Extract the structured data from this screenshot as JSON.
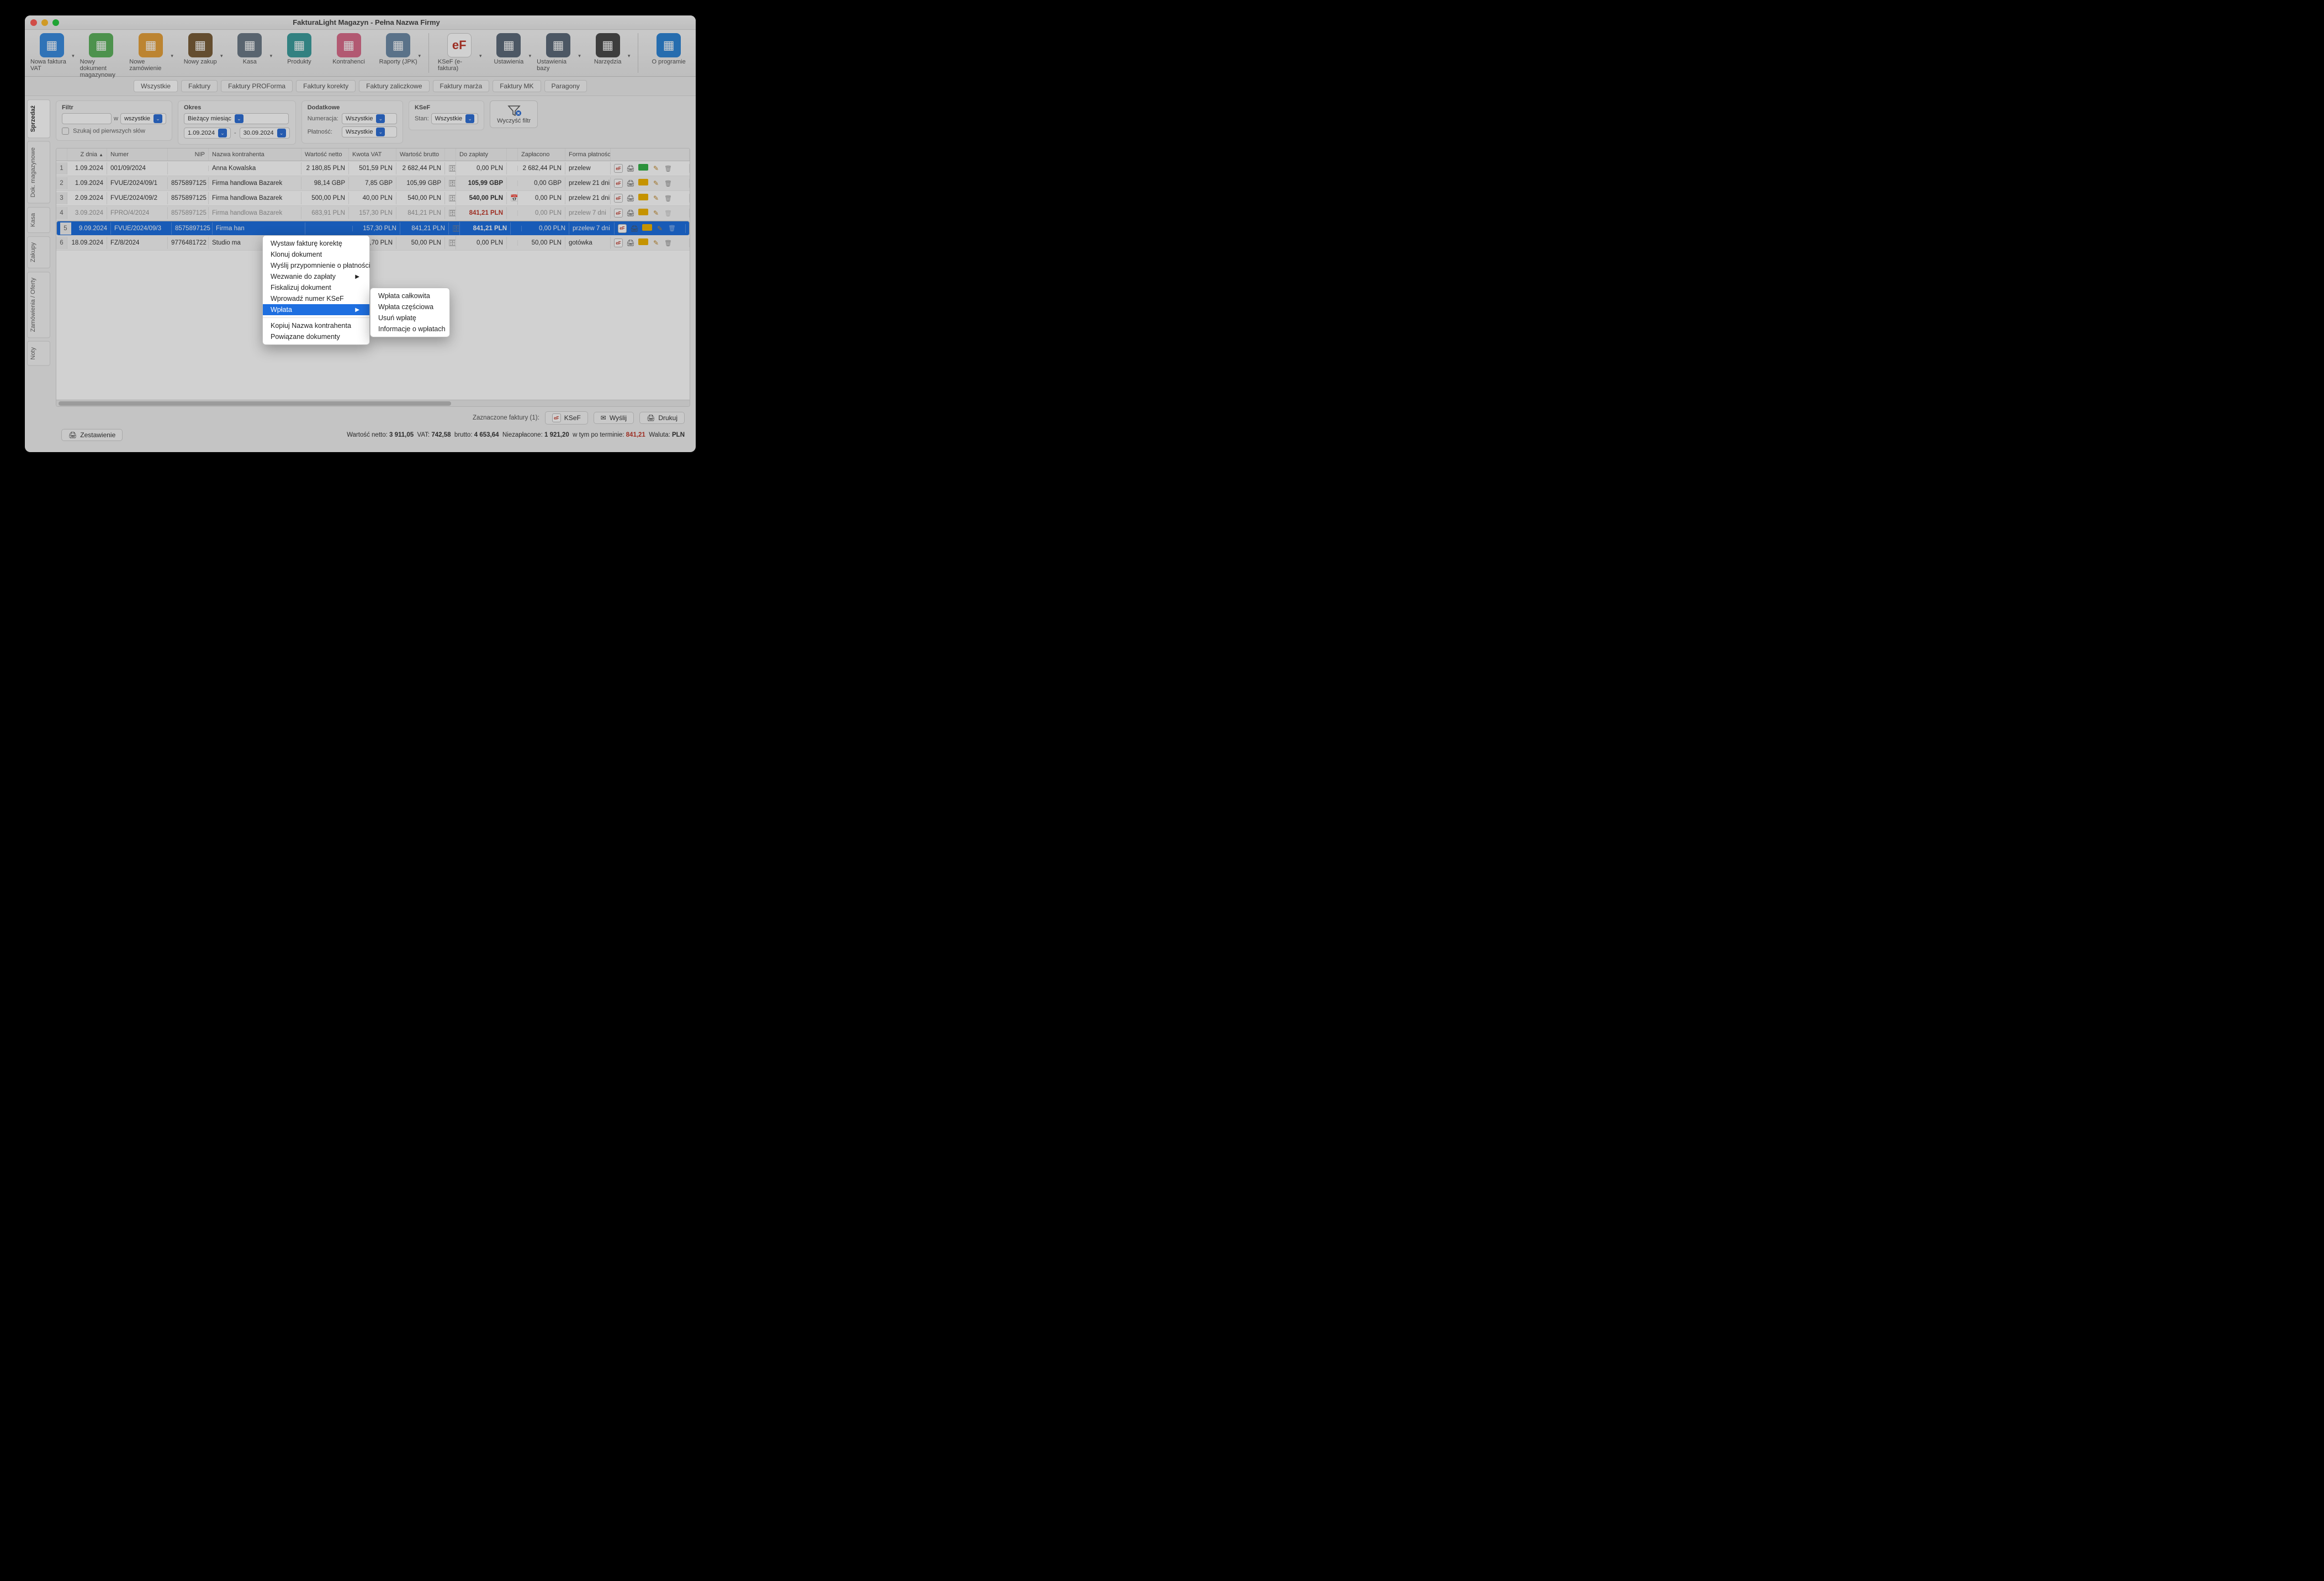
{
  "window": {
    "title": "FakturaLight Magazyn - Pełna Nazwa Firmy"
  },
  "toolbar": [
    {
      "label": "Nowa faktura VAT",
      "icon": "ic-blue",
      "dd": true
    },
    {
      "label": "Nowy dokument magazynowy",
      "icon": "ic-green",
      "dd": false
    },
    {
      "label": "Nowe zamówienie",
      "icon": "ic-orange",
      "dd": true
    },
    {
      "label": "Nowy zakup",
      "icon": "ic-brown",
      "dd": true
    },
    {
      "label": "Kasa",
      "icon": "ic-grey",
      "dd": true
    },
    {
      "label": "Produkty",
      "icon": "ic-teal",
      "dd": false
    },
    {
      "label": "Kontrahenci",
      "icon": "ic-pink",
      "dd": false
    },
    {
      "label": "Raporty (JPK)",
      "icon": "ic-steel",
      "dd": true
    },
    {
      "sep": true
    },
    {
      "label": "KSeF (e-faktura)",
      "icon": "ic-ksef",
      "dd": true
    },
    {
      "label": "Ustawienia",
      "icon": "ic-slate",
      "dd": true
    },
    {
      "label": "Ustawienia bazy",
      "icon": "ic-slate",
      "dd": true
    },
    {
      "label": "Narzędzia",
      "icon": "ic-dark",
      "dd": true
    },
    {
      "sep": true
    },
    {
      "label": "O programie",
      "icon": "ic-info",
      "dd": false
    }
  ],
  "subtabs": [
    "Wszystkie",
    "Faktury",
    "Faktury PROForma",
    "Faktury korekty",
    "Faktury zaliczkowe",
    "Faktury marża",
    "Faktury MK",
    "Paragony"
  ],
  "subtab_active": 0,
  "sidetabs": [
    "Sprzedaż",
    "Dok. magazynowe",
    "Kasa",
    "Zakupy",
    "Zamówienia / Oferty",
    "Noty"
  ],
  "sidetab_active": 0,
  "filters": {
    "flt_label": "Filtr",
    "w": "w",
    "w_sel": "wszystkie",
    "search_first_words": "Szukaj od pierwszych słów",
    "okres_label": "Okres",
    "okres_sel": "Bieżący miesiąc",
    "date_from": "1.09.2024",
    "date_to": "30.09.2024",
    "dash": "-",
    "dodatkowe_label": "Dodatkowe",
    "numeracja_lbl": "Numeracja:",
    "numeracja_sel": "Wszystkie",
    "platnosc_lbl": "Płatność:",
    "platnosc_sel": "Wszystkie",
    "ksef_label": "KSeF",
    "stan_lbl": "Stan:",
    "stan_sel": "Wszystkie",
    "clear_label": "Wyczyść filtr"
  },
  "columns": [
    "",
    "Z dnia",
    "Numer",
    "NIP",
    "Nazwa kontrahenta",
    "Wartość netto",
    "Kwota VAT",
    "Wartość brutto",
    "",
    "Do zapłaty",
    "",
    "Zapłacono",
    "Forma płatności",
    ""
  ],
  "rows": [
    {
      "n": "1",
      "date": "1.09.2024",
      "num": "001/09/2024",
      "nip": "",
      "name": "Anna Kowalska",
      "netto": "2 180,85 PLN",
      "vat": "501,59 PLN",
      "brutto": "2 682,44 PLN",
      "ico": "🗄",
      "due": "0,00 PLN",
      "zap": "2 682,44 PLN",
      "form": "przelew",
      "mail": "green"
    },
    {
      "n": "2",
      "date": "1.09.2024",
      "num": "FVUE/2024/09/1",
      "nip": "8575897125",
      "name": "Firma handlowa Bazarek",
      "netto": "98,14 GBP",
      "vat": "7,85 GBP",
      "brutto": "105,99 GBP",
      "ico": "🗄",
      "due": "105,99 GBP",
      "due_bold": true,
      "zap": "0,00 GBP",
      "form": "przelew 21 dni",
      "mail": "y"
    },
    {
      "n": "3",
      "date": "2.09.2024",
      "num": "FVUE/2024/09/2",
      "nip": "8575897125",
      "name": "Firma handlowa Bazarek",
      "netto": "500,00 PLN",
      "vat": "40,00 PLN",
      "brutto": "540,00 PLN",
      "ico": "🗄",
      "due": "540,00 PLN",
      "due_bold": true,
      "ico2": "📅",
      "zap": "0,00 PLN",
      "form": "przelew 21 dni",
      "mail": "y"
    },
    {
      "n": "4",
      "date": "3.09.2024",
      "num": "FPRO/4/2024",
      "nip": "8575897125",
      "name": "Firma handlowa Bazarek",
      "netto": "683,91 PLN",
      "vat": "157,30 PLN",
      "brutto": "841,21 PLN",
      "ico": "🗄",
      "due": "841,21 PLN",
      "due_red": true,
      "zap": "0,00 PLN",
      "form": "przelew 7 dni",
      "dim": true,
      "mail": "y"
    },
    {
      "n": "5",
      "date": "9.09.2024",
      "num": "FVUE/2024/09/3",
      "nip": "8575897125",
      "name": "Firma han",
      "netto": "",
      "vat": "157,30 PLN",
      "brutto": "841,21 PLN",
      "ico": "🗄",
      "due": "841,21 PLN",
      "due_bold": true,
      "zap": "0,00 PLN",
      "form": "przelew 7 dni",
      "sel": true,
      "mail": "y"
    },
    {
      "n": "6",
      "date": "18.09.2024",
      "num": "FZ/8/2024",
      "nip": "9776481722",
      "name": "Studio ma",
      "netto": "",
      "vat": "3,70 PLN",
      "brutto": "50,00 PLN",
      "ico": "🗄",
      "due": "0,00 PLN",
      "zap": "50,00 PLN",
      "form": "gotówka",
      "mail": "y"
    }
  ],
  "context_menu": {
    "items": [
      "Wystaw fakturę korektę",
      "Klonuj dokument",
      "Wyślij przypomnienie o płatności",
      {
        "label": "Wezwanie do zapłaty",
        "sub": true
      },
      "Fiskalizuj dokument",
      "Wprowadź numer KSeF",
      {
        "label": "Wpłata",
        "sub": true,
        "hl": true
      },
      "---",
      "Kopiuj Nazwa kontrahenta",
      "Powiązane dokumenty"
    ],
    "submenu": [
      "Wpłata całkowita",
      "Wpłata częściowa",
      "Usuń wpłatę",
      "Informacje o wpłatach"
    ]
  },
  "footer": {
    "selected_lbl": "Zaznaczone faktury (1):",
    "btn_ksef": "KSeF",
    "btn_wyslij": "Wyślij",
    "btn_drukuj": "Drukuj",
    "btn_zest": "Zestawienie",
    "sum_netto_lbl": "Wartość netto:",
    "sum_netto": "3 911,05",
    "sum_vat_lbl": "VAT:",
    "sum_vat": "742,58",
    "sum_brutto_lbl": "brutto:",
    "sum_brutto": "4 653,64",
    "sum_niezapl_lbl": "Niezapłacone:",
    "sum_niezapl": "1 921,20",
    "sum_term_lbl": "w tym po terminie:",
    "sum_term": "841,21",
    "sum_waluta_lbl": "Waluta:",
    "sum_waluta": "PLN"
  }
}
